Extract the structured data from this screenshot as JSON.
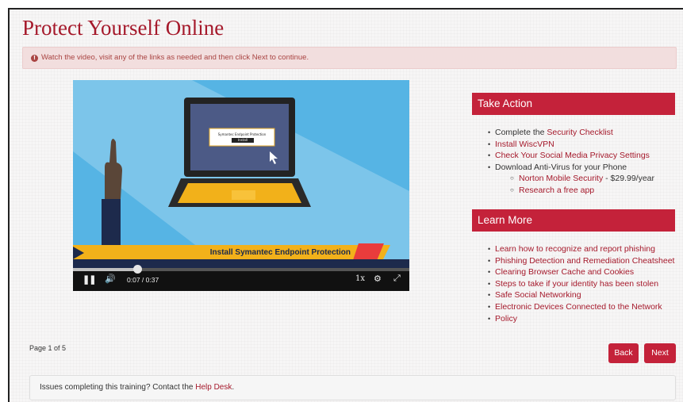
{
  "page": {
    "title": "Protect Yourself Online",
    "alert_text": "Watch the video, visit any of the links as needed and then click Next to continue.",
    "page_indicator": "Page 1 of 5"
  },
  "video": {
    "dialog_title": "Symantec Endpoint Protection",
    "dialog_button": "Install",
    "banner_text": "Install Symantec Endpoint Protection",
    "time": "0:07 / 0:37",
    "speed": "1x",
    "progress_fraction": 0.19
  },
  "take_action": {
    "header": "Take Action",
    "items": [
      {
        "prefix": "Complete the ",
        "link": "Security Checklist",
        "suffix": ""
      },
      {
        "prefix": "",
        "link": "Install WiscVPN",
        "suffix": ""
      },
      {
        "prefix": "",
        "link": "Check Your Social Media Privacy Settings",
        "suffix": ""
      },
      {
        "prefix": "Download Anti-Virus for your Phone",
        "link": "",
        "suffix": ""
      }
    ],
    "sub_items": [
      {
        "prefix": "",
        "link": "Norton Mobile Security",
        "suffix": " - $29.99/year"
      },
      {
        "prefix": "",
        "link": "Research a free app",
        "suffix": ""
      }
    ]
  },
  "learn_more": {
    "header": "Learn More",
    "items": [
      {
        "prefix": "",
        "link": "Learn how to recognize and report phishing",
        "suffix": ""
      },
      {
        "prefix": "",
        "link": "Phishing Detection and Remediation Cheatsheet",
        "suffix": ""
      },
      {
        "prefix": "",
        "link": "Clearing Browser Cache and Cookies",
        "suffix": ""
      },
      {
        "prefix": "",
        "link": "Steps to take if your identity has been stolen",
        "suffix": ""
      },
      {
        "prefix": "",
        "link": "Safe Social Networking",
        "suffix": ""
      },
      {
        "prefix": "",
        "link": "Electronic Devices Connected to the Network",
        "suffix": ""
      },
      {
        "prefix": "",
        "link": "Policy",
        "suffix": ""
      }
    ]
  },
  "buttons": {
    "back": "Back",
    "next": "Next"
  },
  "footer": {
    "prefix": "Issues completing this training? Contact the ",
    "link": "Help Desk",
    "suffix": "."
  },
  "colors": {
    "accent": "#c4223a",
    "title": "#a5192b",
    "alert_bg": "#f2dede"
  }
}
